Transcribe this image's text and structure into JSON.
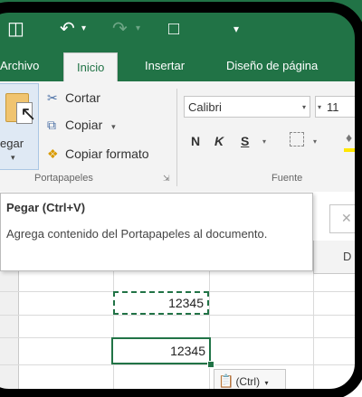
{
  "qat": {
    "save_icon": "save-icon",
    "undo_icon": "undo-icon",
    "redo_icon": "redo-icon",
    "new_icon": "new-document-icon",
    "customize_icon": "customize-qat-icon"
  },
  "tabs": [
    {
      "label": "Archivo",
      "active": false
    },
    {
      "label": "Inicio",
      "active": true
    },
    {
      "label": "Insertar",
      "active": false
    },
    {
      "label": "Diseño de página",
      "active": false
    }
  ],
  "clipboard": {
    "paste_label": "egar",
    "cut_label": "Cortar",
    "copy_label": "Copiar",
    "copy_format_label": "Copiar formato",
    "group_label": "Portapapeles"
  },
  "font": {
    "name": "Calibri",
    "size": "11",
    "bold": "N",
    "italic": "K",
    "underline": "S",
    "group_label": "Fuente"
  },
  "tooltip": {
    "title": "Pegar (Ctrl+V)",
    "description": "Agrega contenido del Portapapeles al documento."
  },
  "sheet": {
    "column_header": "D",
    "source_value": "12345",
    "dest_value": "12345",
    "paste_options_label": "(Ctrl)"
  },
  "colors": {
    "excel_green": "#217346",
    "ribbon_bg": "#f3f3f3"
  }
}
